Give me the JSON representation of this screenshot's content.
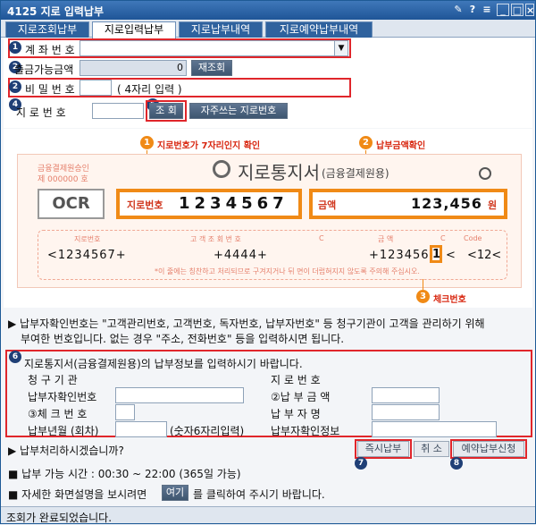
{
  "title": "4125 지로 입력납부",
  "tabs": [
    {
      "label": "지로조회납부"
    },
    {
      "label": "지로입력납부"
    },
    {
      "label": "지로납부내역"
    },
    {
      "label": "지로예약납부내역"
    }
  ],
  "account": {
    "label": "계 좌 번 호"
  },
  "balance": {
    "label": "출금가능금액",
    "value": "0",
    "button": "재조회"
  },
  "password": {
    "label": "비 밀 번 호",
    "hint": "( 4자리 입력 )"
  },
  "giro": {
    "label": "지 로 번 호",
    "search_button": "조 회",
    "fav_button": "자주쓰는 지로번호"
  },
  "sample": {
    "institution": "금융결제원승인",
    "institution_no": "제 000000 호",
    "brand": "지로통지서",
    "brand_sub": "(금융결제원용)",
    "ocr": "OCR",
    "giro_label": "지로번호",
    "giro_number": "1234567",
    "amount_label": "금액",
    "amount": "123,456",
    "won": "원",
    "col1": "지로번호",
    "col2": "고 객 조 회 번 호",
    "col3": "금   액",
    "mark_c1": "C",
    "mark_c2": "C",
    "mark_code": "Code",
    "code1": "<1234567+",
    "code2": "+4444+",
    "code3": "+123456",
    "check_digit": "1",
    "code4": "<",
    "code5": "<12<",
    "warn": "*이 줄에는 칭찬하고 처리되므로 구겨지거나 뒤 면이 더럽혀지지 않도록 주의해 주십시오."
  },
  "callouts": {
    "c1": "지로번호가 7자리인지 확인",
    "c2": "납부금액확인",
    "c3": "체크번호"
  },
  "info": "▶ 납부자확인번호는 \"고객관리번호, 고객번호, 독자번호, 납부자번호\" 등 청구기관이 고객을 관리하기 위해",
  "info2": "부여한 번호입니다. 없는 경우 \"주소, 전화번호\" 등을 입력하시면 됩니다.",
  "form": {
    "heading": "지로통지서(금융결제원용)의 납부정보를 입력하시기 바랍니다.",
    "billing_org": "청 구 기 관",
    "giro_no": "지 로 번 호",
    "payer_id": "납부자확인번호",
    "amount": "②납 부 금 액",
    "check": "③체 크 번 호",
    "payer_name": "납 부 자 명",
    "period": "납부년월 (회차)",
    "period_hint": "(숫자6자리입력)",
    "payer_info": "납부자확인정보"
  },
  "question": "▶ 납부처리하시겠습니까?",
  "actions": {
    "pay_now": "즉시납부",
    "cancel": "취 소",
    "reserve": "예약납부신청"
  },
  "footer": {
    "hours": "■ 납부 가능 시간 : 00:30 ~ 22:00 (365일 가능)",
    "help_pre": "■ 자세한 화면설명을 보시려면",
    "help_btn": "여기",
    "help_post": "를 클릭하여 주시기 바랍니다."
  },
  "status": "조회가 완료되었습니다.",
  "colors": {
    "title": "#2a5f9e",
    "highlight": "#e0262b",
    "orange": "#f08a16"
  }
}
